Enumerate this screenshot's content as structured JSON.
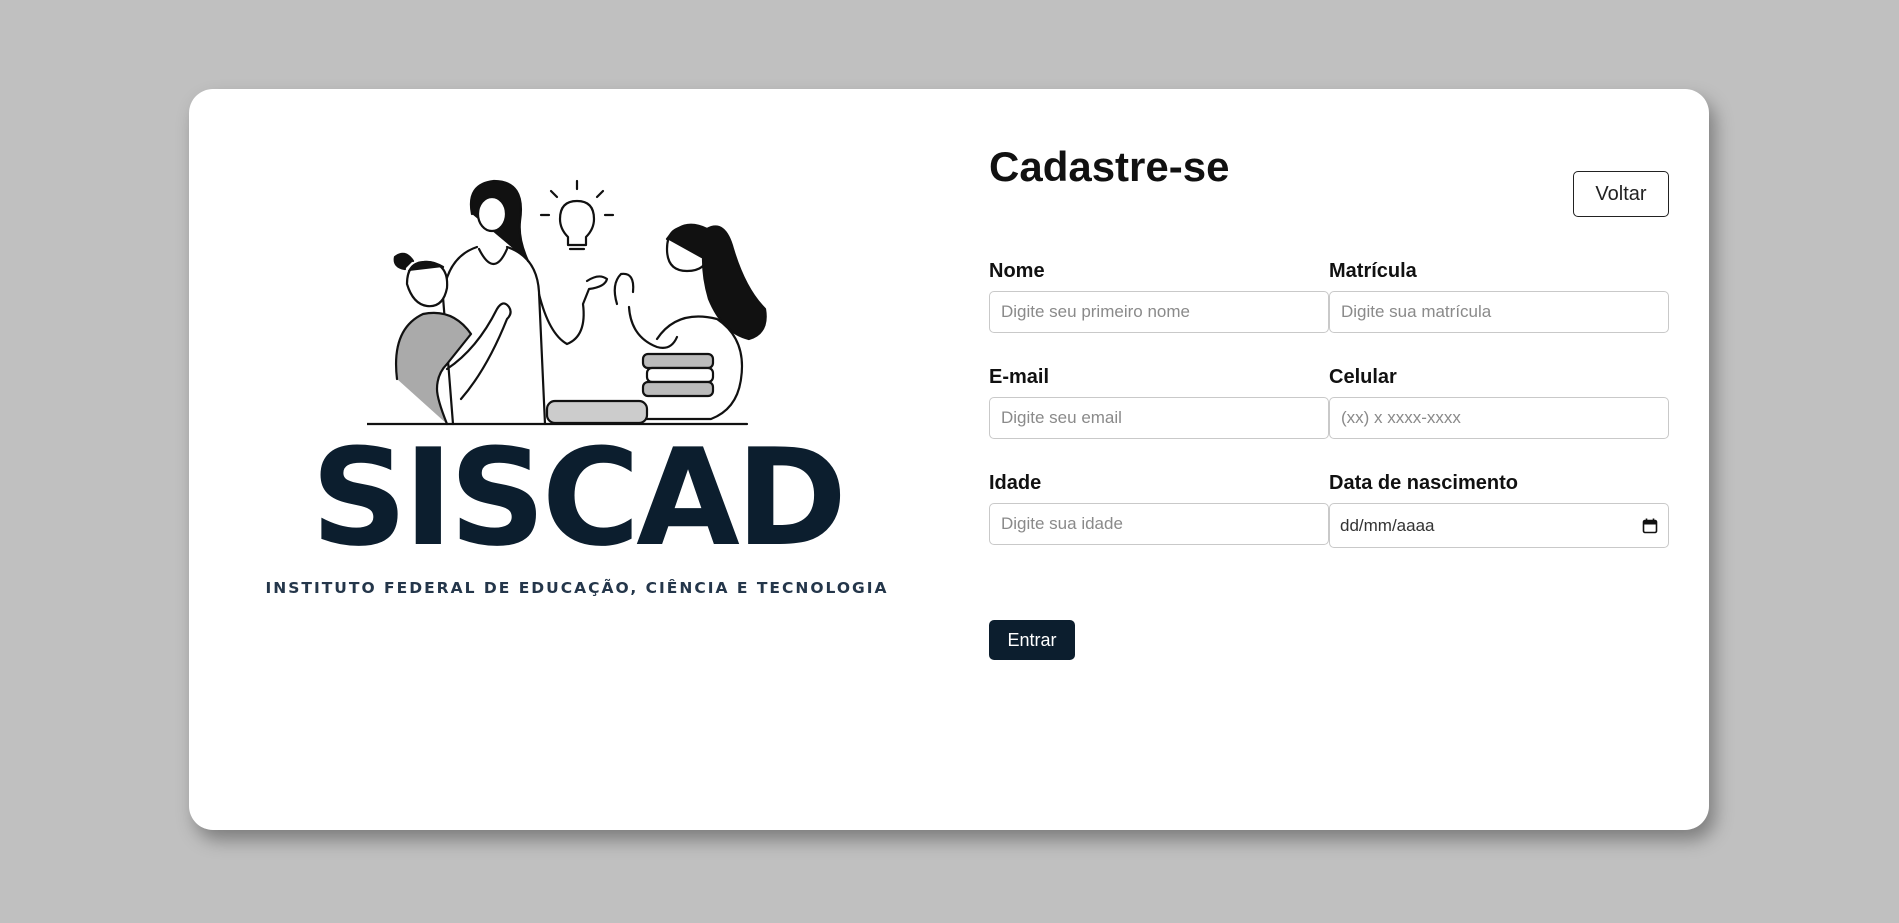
{
  "logo": {
    "brand_name": "SISCAD",
    "subtitle": "INSTITUTO FEDERAL DE EDUCAÇÃO, CIÊNCIA E TECNOLOGIA"
  },
  "form": {
    "title": "Cadastre-se",
    "back_label": "Voltar",
    "fields": {
      "nome": {
        "label": "Nome",
        "placeholder": "Digite seu primeiro nome"
      },
      "matricula": {
        "label": "Matrícula",
        "placeholder": "Digite sua matrícula"
      },
      "email": {
        "label": "E-mail",
        "placeholder": "Digite seu email"
      },
      "celular": {
        "label": "Celular",
        "placeholder": "(xx) x xxxx-xxxx"
      },
      "idade": {
        "label": "Idade",
        "placeholder": "Digite sua idade"
      },
      "nascimento": {
        "label": "Data de nascimento",
        "placeholder": "dd/mm/aaaa"
      }
    },
    "submit_label": "Entrar"
  },
  "colors": {
    "page_background": "#c0c0c0",
    "brand_dark": "#0c1e2e",
    "card": "#ffffff"
  }
}
